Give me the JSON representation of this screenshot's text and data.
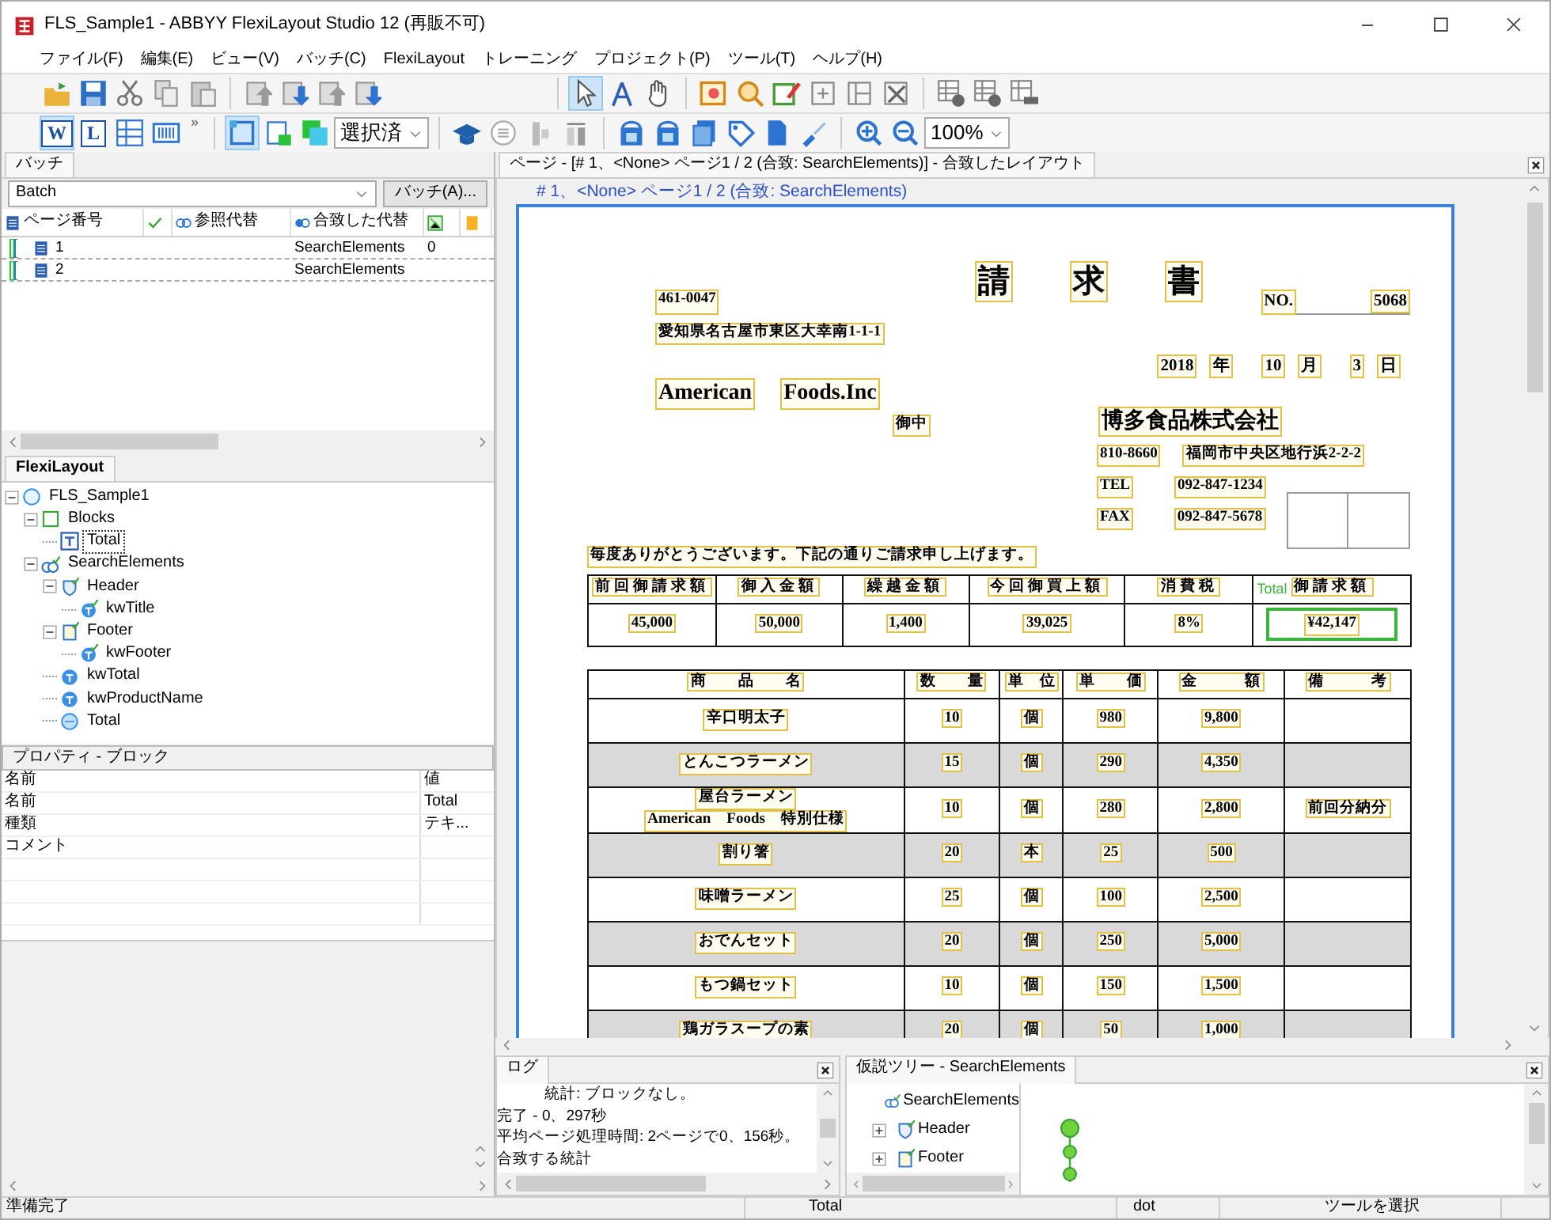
{
  "window": {
    "title": "FLS_Sample1 - ABBYY FlexiLayout Studio 12 (再販不可)"
  },
  "menu": [
    "ファイル(F)",
    "編集(E)",
    "ビュー(V)",
    "バッチ(C)",
    "FlexiLayout",
    "トレーニング",
    "プロジェクト(P)",
    "ツール(T)",
    "ヘルプ(H)"
  ],
  "toolbars": [
    {
      "items": [
        {
          "kind": "button",
          "selected": false
        },
        {
          "kind": "button",
          "selected": false
        },
        {
          "kind": "button",
          "selected": false
        },
        {
          "kind": "button",
          "selected": false
        },
        {
          "kind": "button",
          "selected": false
        },
        {
          "kind": "separator"
        },
        {
          "kind": "button",
          "selected": false
        },
        {
          "kind": "button",
          "selected": false
        },
        {
          "kind": "button",
          "selected": false
        },
        {
          "kind": "button",
          "selected": false
        },
        {
          "kind": "spacer"
        },
        {
          "kind": "separator"
        },
        {
          "kind": "button",
          "selected": true
        },
        {
          "kind": "button",
          "selected": false
        },
        {
          "kind": "button",
          "selected": false
        },
        {
          "kind": "separator"
        },
        {
          "kind": "button",
          "selected": false
        },
        {
          "kind": "button",
          "selected": false
        },
        {
          "kind": "button",
          "selected": false
        },
        {
          "kind": "button",
          "selected": false
        },
        {
          "kind": "button",
          "selected": false
        },
        {
          "kind": "button",
          "selected": false
        },
        {
          "kind": "separator"
        },
        {
          "kind": "button",
          "selected": false
        },
        {
          "kind": "button",
          "selected": false
        },
        {
          "kind": "button",
          "selected": false
        }
      ]
    },
    {
      "items": [
        {
          "kind": "label",
          "label": "W",
          "selected": true
        },
        {
          "kind": "label",
          "label": "L",
          "selected": false
        },
        {
          "kind": "button",
          "selected": false
        },
        {
          "kind": "button",
          "selected": false
        },
        {
          "kind": "overflow",
          "label": "»"
        },
        {
          "kind": "separator"
        },
        {
          "kind": "button",
          "selected": true
        },
        {
          "kind": "button",
          "selected": false
        },
        {
          "kind": "button",
          "selected": false
        },
        {
          "kind": "combo",
          "value": "選択済"
        },
        {
          "kind": "separator"
        },
        {
          "kind": "button",
          "selected": false
        },
        {
          "kind": "button",
          "selected": false
        },
        {
          "kind": "button",
          "selected": false
        },
        {
          "kind": "button",
          "selected": false
        },
        {
          "kind": "separator"
        },
        {
          "kind": "button",
          "selected": false
        },
        {
          "kind": "button",
          "selected": false
        },
        {
          "kind": "button",
          "selected": false
        },
        {
          "kind": "button",
          "selected": false
        },
        {
          "kind": "button",
          "selected": false
        },
        {
          "kind": "button",
          "selected": false
        },
        {
          "kind": "separator"
        },
        {
          "kind": "button",
          "selected": false
        },
        {
          "kind": "button",
          "selected": false
        },
        {
          "kind": "combo",
          "value": "100%"
        }
      ]
    }
  ],
  "batch_panel": {
    "tab": "バッチ",
    "combo": "Batch",
    "button": "バッチ(A)...",
    "columns": [
      {
        "kind": "page",
        "label": "ページ番号"
      },
      {
        "kind": "check"
      },
      {
        "kind": "reference",
        "label": "参照代替"
      },
      {
        "kind": "matched",
        "label": "合致した代替"
      },
      {
        "kind": "image"
      },
      {
        "kind": "note"
      }
    ],
    "rows": [
      {
        "page": "1",
        "layout": "SearchElements",
        "count": "0"
      },
      {
        "page": "2",
        "layout": "SearchElements"
      }
    ]
  },
  "flexilayout": {
    "tab": "FlexiLayout",
    "tree": [
      {
        "label": "FLS_Sample1",
        "kind": "layout",
        "expanded": true,
        "selected": false,
        "children": [
          {
            "label": "Blocks",
            "kind": "blocks",
            "expanded": true,
            "selected": false,
            "children": [
              {
                "label": "Total",
                "kind": "text-block",
                "selected": true
              }
            ]
          },
          {
            "label": "SearchElements",
            "kind": "search",
            "expanded": true,
            "selected": false,
            "children": [
              {
                "label": "Header",
                "kind": "header",
                "expanded": true,
                "selected": false,
                "children": [
                  {
                    "label": "kwTitle",
                    "kind": "element-checked",
                    "selected": false
                  }
                ]
              },
              {
                "label": "Footer",
                "kind": "footer",
                "expanded": true,
                "selected": false,
                "children": [
                  {
                    "label": "kwFooter",
                    "kind": "element-checked",
                    "selected": false
                  }
                ]
              },
              {
                "label": "kwTotal",
                "kind": "element",
                "selected": false
              },
              {
                "label": "kwProductName",
                "kind": "element",
                "selected": false
              },
              {
                "label": "Total",
                "kind": "group",
                "selected": false
              }
            ]
          }
        ]
      }
    ]
  },
  "properties": {
    "title": "プロパティ - ブロック",
    "columns": [
      "名前",
      "値"
    ],
    "rows": [
      {
        "name": "名前",
        "value": "Total"
      },
      {
        "name": "種類",
        "value": "テキ..."
      },
      {
        "name": "コメント"
      }
    ]
  },
  "document": {
    "tab": "ページ - [# 1、<None> ページ1 / 2 (合致: SearchElements)] - 合致したレイアウト",
    "caption": "# 1、<None> ページ1 / 2 (合致: SearchElements)",
    "invoice": {
      "title": [
        "請",
        "求",
        "書"
      ],
      "postal": "461-0047",
      "no_label": "NO.",
      "no_value": "5068",
      "address": "愛知県名古屋市東区大幸南1-1-1",
      "date": [
        "2018",
        "年",
        "10",
        "月",
        "3",
        "日"
      ],
      "customer": [
        "American",
        "Foods.Inc"
      ],
      "honorific": "御中",
      "company": "博多食品株式会社",
      "company_lines": [
        [
          "810-8660",
          "福岡市中央区地行浜2-2-2"
        ],
        [
          "TEL",
          "092-847-1234"
        ],
        [
          "FAX",
          "092-847-5678"
        ]
      ],
      "greeting": "毎度ありがとうございます。下記の通りご請求申し上げます。",
      "summary": [
        {
          "header": "前回御請求額",
          "value": "45,000",
          "selected": false
        },
        {
          "header": "御入金額",
          "value": "50,000",
          "selected": false
        },
        {
          "header": "繰越金額",
          "value": "1,400",
          "selected": false
        },
        {
          "header": "今回御買上額",
          "value": "39,025",
          "selected": false
        },
        {
          "header": "消費税",
          "value": "8%",
          "selected": false
        },
        {
          "header": "御請求額",
          "value": "¥42,147",
          "selected": true,
          "block_label": "Total"
        }
      ],
      "columns": [
        "商　　品　　名",
        "数　　量",
        "単　位",
        "単　　価",
        "金　　　額",
        "備　　　考"
      ],
      "rows": [
        {
          "name": [
            "辛口明太子"
          ],
          "qty": "10",
          "unit": "個",
          "price": "980",
          "amount": "9,800",
          "shaded": false
        },
        {
          "name": [
            "とんこつラーメン"
          ],
          "qty": "15",
          "unit": "個",
          "price": "290",
          "amount": "4,350",
          "shaded": true
        },
        {
          "name": [
            "屋台ラーメン",
            "American　Foods　特別仕様"
          ],
          "qty": "10",
          "unit": "個",
          "price": "280",
          "amount": "2,800",
          "note": "前回分納分",
          "shaded": false
        },
        {
          "name": [
            "割り箸"
          ],
          "qty": "20",
          "unit": "本",
          "price": "25",
          "amount": "500",
          "shaded": true
        },
        {
          "name": [
            "味噌ラーメン"
          ],
          "qty": "25",
          "unit": "個",
          "price": "100",
          "amount": "2,500",
          "shaded": false
        },
        {
          "name": [
            "おでんセット"
          ],
          "qty": "20",
          "unit": "個",
          "price": "250",
          "amount": "5,000",
          "shaded": true
        },
        {
          "name": [
            "もつ鍋セット"
          ],
          "qty": "10",
          "unit": "個",
          "price": "150",
          "amount": "1,500",
          "shaded": false
        },
        {
          "name": [
            "鶏ガラスープの素"
          ],
          "qty": "20",
          "unit": "個",
          "price": "50",
          "amount": "1,000",
          "shaded": true
        }
      ]
    }
  },
  "log": {
    "tab": "ログ",
    "lines": [
      {
        "text": "統計: ブロックなし。",
        "indent": true
      },
      {
        "text": "完了 - 0、297秒",
        "indent": false
      },
      {
        "text": "平均ページ処理時間: 2ページで0、156秒。",
        "indent": false
      },
      {
        "text": "合致する統計",
        "indent": false
      }
    ]
  },
  "hypothesis": {
    "tab": "仮説ツリー - SearchElements",
    "items": [
      {
        "label": "SearchElements",
        "kind": "search"
      },
      {
        "label": "Header",
        "kind": "header",
        "expanded": false
      },
      {
        "label": "Footer",
        "kind": "footer",
        "expanded": false
      }
    ]
  },
  "status_bar": [
    "準備完了",
    "Total",
    "dot",
    "ツールを選択"
  ]
}
